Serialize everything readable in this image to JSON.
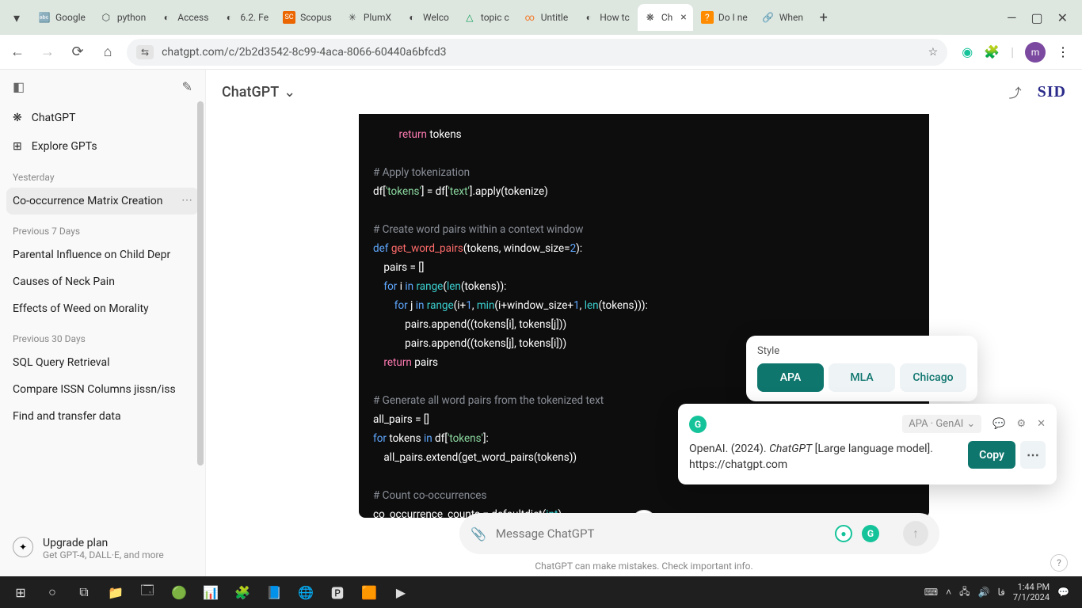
{
  "browser": {
    "tabs": [
      {
        "favicon": "🔤",
        "title": "Google"
      },
      {
        "favicon": "⬡",
        "title": "python"
      },
      {
        "favicon": "◐",
        "title": "Access"
      },
      {
        "favicon": "◐",
        "title": "6.2. Fe"
      },
      {
        "favicon": "SC",
        "title": "Scopus"
      },
      {
        "favicon": "✳",
        "title": "PlumX"
      },
      {
        "favicon": "◐",
        "title": "Welco"
      },
      {
        "favicon": "△",
        "title": "topic c"
      },
      {
        "favicon": "∞",
        "title": "Untitle"
      },
      {
        "favicon": "◐",
        "title": "How tc"
      },
      {
        "favicon": "❋",
        "title": "Ch"
      },
      {
        "favicon": "?",
        "title": "Do I ne"
      },
      {
        "favicon": "🔗",
        "title": "When"
      }
    ],
    "url": "chatgpt.com/c/2b2d3542-8c99-4aca-8066-60440a6bfcd3"
  },
  "sidebar": {
    "chatgpt_label": "ChatGPT",
    "explore_label": "Explore GPTs",
    "sections": {
      "yesterday": "Yesterday",
      "prev7": "Previous 7 Days",
      "prev30": "Previous 30 Days"
    },
    "chats_yesterday": [
      "Co-occurrence Matrix Creation"
    ],
    "chats_prev7": [
      "Parental Influence on Child Depr",
      "Causes of Neck Pain",
      "Effects of Weed on Morality"
    ],
    "chats_prev30": [
      "SQL Query Retrieval",
      "Compare ISSN Columns jissn/iss",
      "Find and transfer data"
    ],
    "upgrade_title": "Upgrade plan",
    "upgrade_sub": "Get GPT-4, DALL·E, and more"
  },
  "main": {
    "title": "ChatGPT",
    "sid": "SID",
    "composer_placeholder": "Message ChatGPT",
    "footer": "ChatGPT can make mistakes. Check important info."
  },
  "code": {
    "l1a": "return",
    "l1b": " tokens",
    "l2": "# Apply tokenization",
    "l3a": "df[",
    "l3b": "'tokens'",
    "l3c": "] = df[",
    "l3d": "'text'",
    "l3e": "].apply(tokenize)",
    "l4": "# Create word pairs within a context window",
    "l5a": "def",
    "l5b": " get_word_pairs",
    "l5c": "(tokens, window_size=",
    "l5d": "2",
    "l5e": "):",
    "l6": "    pairs = []",
    "l7a": "    for",
    "l7b": " i ",
    "l7c": "in",
    "l7d": " range",
    "l7e": "(",
    "l7f": "len",
    "l7g": "(tokens)):",
    "l8a": "        for",
    "l8b": " j ",
    "l8c": "in",
    "l8d": " range",
    "l8e": "(i+",
    "l8f": "1",
    "l8g": ", ",
    "l8h": "min",
    "l8i": "(i+window_size+",
    "l8j": "1",
    "l8k": ", ",
    "l8l": "len",
    "l8m": "(tokens))):",
    "l9": "            pairs.append((tokens[i], tokens[j]))",
    "l10": "            pairs.append((tokens[j], tokens[i]))",
    "l11a": "    return",
    "l11b": " pairs",
    "l12": "# Generate all word pairs from the tokenized text",
    "l13": "all_pairs = []",
    "l14a": "for",
    "l14b": " tokens ",
    "l14c": "in",
    "l14d": " df[",
    "l14e": "'tokens'",
    "l14f": "]:",
    "l15": "    all_pairs.extend(get_word_pairs(tokens))",
    "l16": "# Count co-occurrences",
    "l17a": "co_occurrence_counts = defaultdict(",
    "l17b": "int",
    "l17c": ")"
  },
  "style_popup": {
    "label": "Style",
    "apa": "APA",
    "mla": "MLA",
    "chicago": "Chicago"
  },
  "citation": {
    "source": "APA · GenAI",
    "text_pre": "OpenAI. (2024). ",
    "text_em": "ChatGPT",
    "text_post": " [Large language model]. https://chatgpt.com",
    "copy": "Copy",
    "more": "⋯"
  },
  "taskbar": {
    "time": "1:44 PM",
    "date": "7/1/2024",
    "lang": "فا"
  }
}
